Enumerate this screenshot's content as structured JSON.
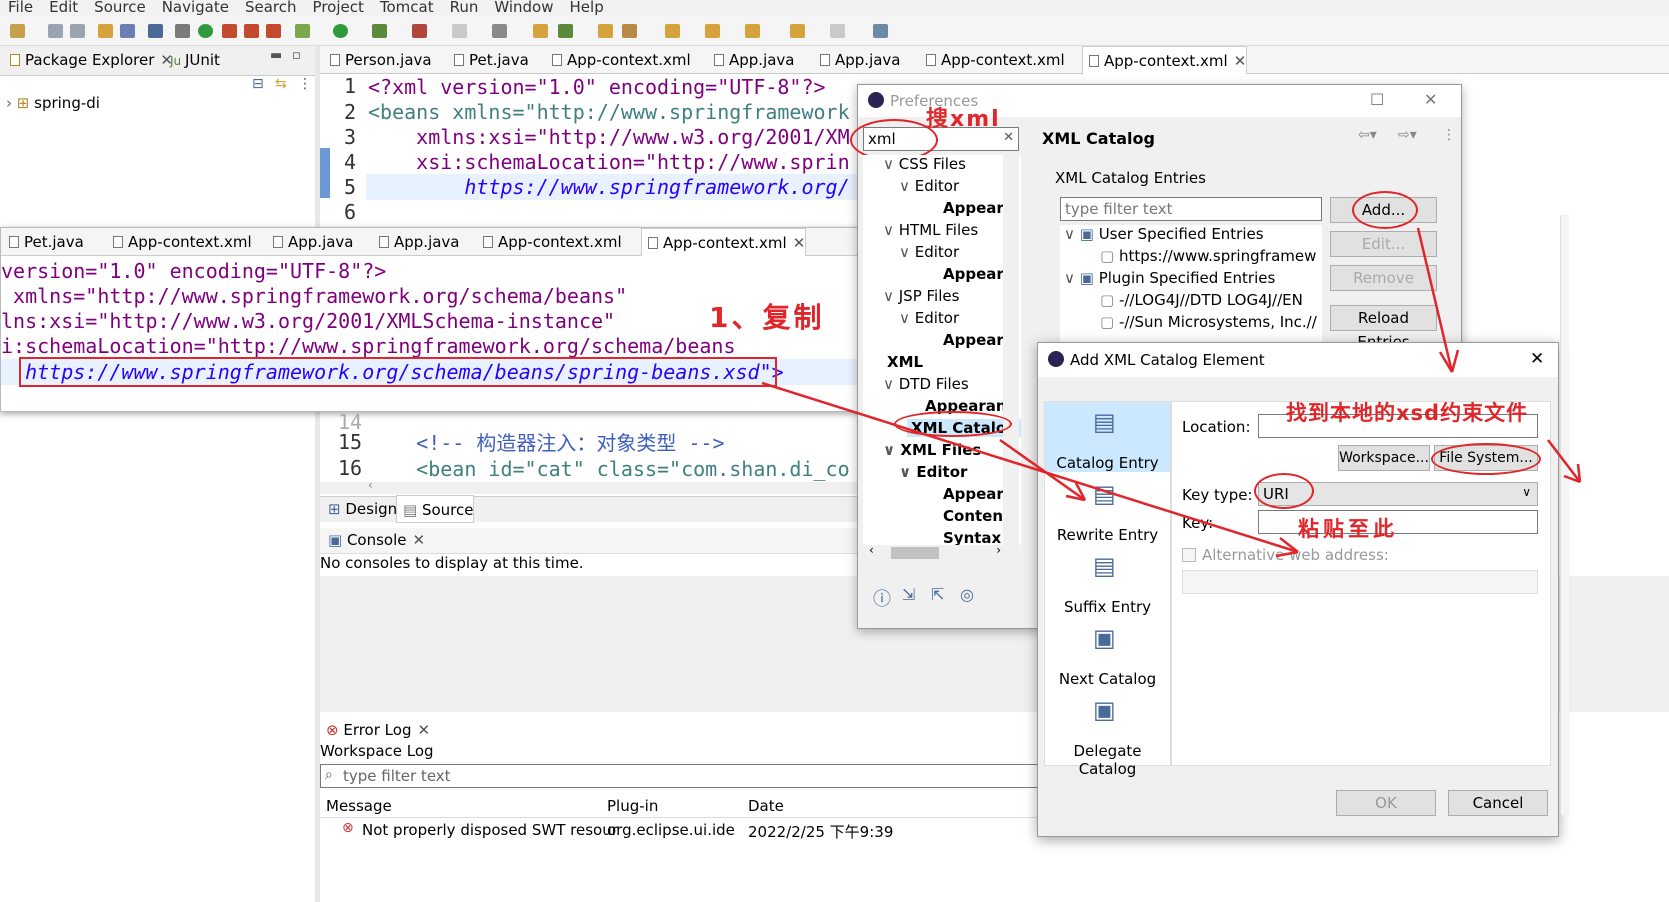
{
  "menu": [
    "File",
    "Edit",
    "Source",
    "Navigate",
    "Search",
    "Project",
    "Tomcat",
    "Run",
    "Window",
    "Help"
  ],
  "left_tabs": {
    "package_explorer": "Package Explorer",
    "junit": "JUnit"
  },
  "project": "spring-di",
  "editor_tabs": [
    "Person.java",
    "Pet.java",
    "App-context.xml",
    "App.java",
    "App.java",
    "App-context.xml",
    "App-context.xml"
  ],
  "editor_back_lines": [
    {
      "n": "1",
      "text": "<?xml version=\"1.0\" encoding=\"UTF-8\"?>"
    },
    {
      "n": "2",
      "text": "<beans xmlns=\"http://www.springframework"
    },
    {
      "n": "3",
      "text": "    xmlns:xsi=\"http://www.w3.org/2001/XM"
    },
    {
      "n": "4",
      "text": "    xsi:schemaLocation=\"http://www.sprin"
    },
    {
      "n": "5",
      "text": "        https://www.springframework.org/"
    },
    {
      "n": "6",
      "text": ""
    }
  ],
  "zoom_tabs": [
    "Pet.java",
    "App-context.xml",
    "App.java",
    "App.java",
    "App-context.xml",
    "App-context.xml"
  ],
  "zoom_lines": [
    "version=\"1.0\" encoding=\"UTF-8\"?>",
    " xmlns=\"http://www.springframework.org/schema/beans\"",
    "lns:xsi=\"http://www.w3.org/2001/XMLSchema-instance\"",
    "i:schemaLocation=\"http://www.springframework.org/schema/beans",
    "  https://www.springframework.org/schema/beans/spring-beans.xsd\">"
  ],
  "annotations": {
    "copy": "1、复制",
    "search_xml": "搜xml",
    "find_local": "找到本地的xsd约束文件",
    "paste_here": "粘贴至此"
  },
  "editor_lower": [
    {
      "n": "14",
      "text": ""
    },
    {
      "n": "15",
      "text": "    <!-- 构造器注入：对象类型 -->"
    },
    {
      "n": "16",
      "text": "    <bean id=\"cat\" class=\"com.shan.di_co"
    }
  ],
  "design_tabs": {
    "design": "Design",
    "source": "Source"
  },
  "console": {
    "title": "Console",
    "message": "No consoles to display at this time."
  },
  "error_log": {
    "title": "Error Log",
    "subtitle": "Workspace Log",
    "filter": "type filter text",
    "columns": [
      "Message",
      "Plug-in",
      "Date"
    ],
    "rows": [
      {
        "message": "Not properly disposed SWT resour",
        "plugin": "org.eclipse.ui.ide",
        "date": "2022/2/25 下午9:39"
      }
    ]
  },
  "preferences": {
    "title": "Preferences",
    "search_value": "xml",
    "tree": [
      {
        "label": "CSS Files",
        "depth": 0
      },
      {
        "label": "Editor",
        "depth": 1
      },
      {
        "label": "Appeara",
        "depth": 2
      },
      {
        "label": "HTML Files",
        "depth": 0
      },
      {
        "label": "Editor",
        "depth": 1
      },
      {
        "label": "Appeara",
        "depth": 2
      },
      {
        "label": "JSP Files",
        "depth": 0
      },
      {
        "label": "Editor",
        "depth": 1
      },
      {
        "label": "Appeara",
        "depth": 2
      },
      {
        "label": "XML",
        "depth": -1
      },
      {
        "label": "DTD Files",
        "depth": 0
      },
      {
        "label": "Appearanc",
        "depth": 2
      },
      {
        "label": "XML Catalog",
        "depth": 1
      },
      {
        "label": "XML Files",
        "depth": 0
      },
      {
        "label": "Editor",
        "depth": 1
      },
      {
        "label": "Appeara",
        "depth": 2
      },
      {
        "label": "Content",
        "depth": 2
      },
      {
        "label": "Syntax C",
        "depth": 2
      }
    ],
    "page_title": "XML Catalog",
    "entries_label": "XML Catalog Entries",
    "filter_placeholder": "type filter text",
    "entries": [
      {
        "label": "User Specified Entries",
        "depth": 0
      },
      {
        "label": "https://www.springframew",
        "depth": 1
      },
      {
        "label": "Plugin Specified Entries",
        "depth": 0
      },
      {
        "label": "-//LOG4J//DTD LOG4J//EN",
        "depth": 1
      },
      {
        "label": "-//Sun Microsystems, Inc.//",
        "depth": 1
      }
    ],
    "buttons": {
      "add": "Add...",
      "edit": "Edit...",
      "remove": "Remove",
      "reload": "Reload Entries"
    }
  },
  "add_dialog": {
    "title": "Add XML Catalog Element",
    "left_items": [
      "Catalog Entry",
      "Rewrite Entry",
      "Suffix Entry",
      "Next Catalog",
      "Delegate Catalog"
    ],
    "location_label": "Location:",
    "workspace_btn": "Workspace...",
    "filesystem_btn": "File System...",
    "keytype_label": "Key type:",
    "keytype_value": "URI",
    "key_label": "Key:",
    "alt_label": "Alternative web address:",
    "ok": "OK",
    "cancel": "Cancel"
  }
}
